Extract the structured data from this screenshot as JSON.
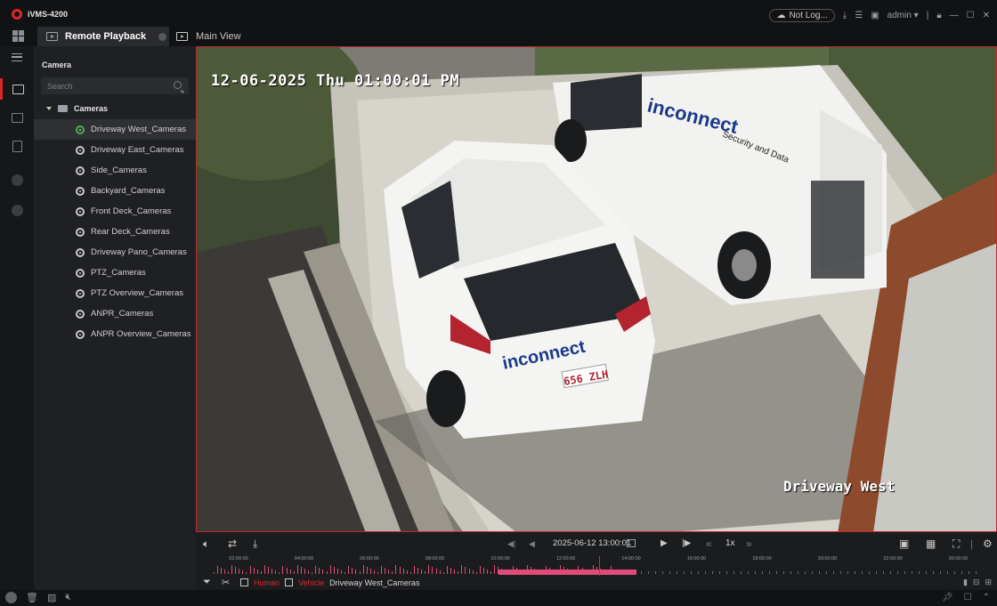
{
  "app": {
    "title": "iVMS-4200"
  },
  "titlebar": {
    "not_logged": "Not Log...",
    "user": "admin",
    "icons": [
      "cloud-icon",
      "download-icon",
      "list-icon",
      "screen-icon",
      "user-dropdown-icon",
      "lock-icon",
      "minimize-icon",
      "maximize-icon",
      "close-icon"
    ]
  },
  "tabs": {
    "active": "Remote Playback",
    "second": "Main View"
  },
  "panel": {
    "title": "Camera",
    "search_placeholder": "Search",
    "root": "Cameras",
    "cameras": [
      "Driveway West_Cameras",
      "Driveway East_Cameras",
      "Side_Cameras",
      "Backyard_Cameras",
      "Front Deck_Cameras",
      "Rear Deck_Cameras",
      "Driveway Pano_Cameras",
      "PTZ_Cameras",
      "PTZ Overview_Cameras",
      "ANPR_Cameras",
      "ANPR Overview_Cameras"
    ],
    "selected_index": 0
  },
  "video": {
    "osd_time": "12-06-2025 Thu 01:00:01 PM",
    "osd_name": "Driveway West",
    "van_text": "inconnect",
    "van_subtext": "Security and Data",
    "plate": "656 ZLH"
  },
  "playback": {
    "datetime": "2025-06-12 13:00:01",
    "speed": "1x",
    "timeline_labels": [
      "02:00:00",
      "04:00:00",
      "06:00:00",
      "08:00:00",
      "10:00:00",
      "12:00:00",
      "14:00:00",
      "16:00:00",
      "18:00:00",
      "20:00:00",
      "22:00:00",
      "00:00:00"
    ],
    "cursor_time_fraction": 0.5417
  },
  "filters": {
    "human": "Human",
    "vehicle": "Vehicle",
    "camera": "Driveway West_Cameras"
  },
  "colors": {
    "accent": "#e0262b",
    "timeline_record": "#e04b7a",
    "online": "#4caf50"
  }
}
